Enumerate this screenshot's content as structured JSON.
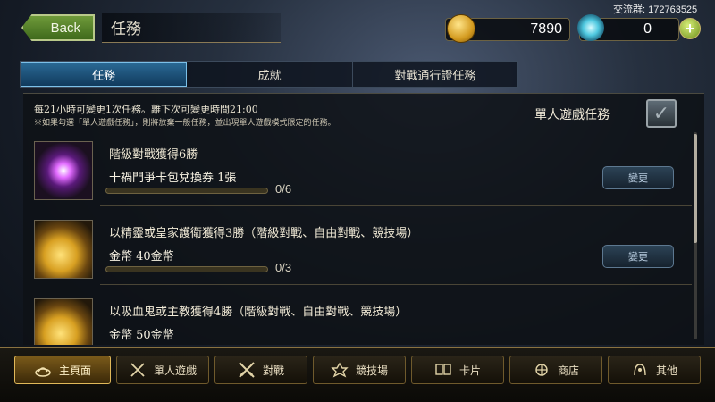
{
  "watermark": "交流群: 172763525",
  "header": {
    "back_label": "Back",
    "title": "任務"
  },
  "currency": {
    "gold": "7890",
    "crystals": "0",
    "add_label": "+"
  },
  "tabs": [
    {
      "label": "任務",
      "active": true
    },
    {
      "label": "成就",
      "active": false
    },
    {
      "label": "對戰通行證任務",
      "active": false
    }
  ],
  "info": {
    "line1": "每21小時可變更1次任務。離下次可變更時間21:00",
    "line2": "※如果勾選「單人遊戲任務」，則將放棄一般任務，並出現單人遊戲模式限定的任務。"
  },
  "solo_toggle": {
    "label": "單人遊戲任務",
    "checked": true
  },
  "missions": [
    {
      "title": "階級對戰獲得6勝",
      "reward": "十禍門爭卡包兌換券 1張",
      "progress": "0/6",
      "progress_fraction": 0,
      "button": "變更",
      "icon": "card-pack-icon"
    },
    {
      "title": "以精靈或皇家護衛獲得3勝（階級對戰、自由對戰、競技場）",
      "reward": "金幣 40金幣",
      "progress": "0/3",
      "progress_fraction": 0,
      "button": "變更",
      "icon": "gold-coins-icon"
    },
    {
      "title": "以吸血鬼或主教獲得4勝（階級對戰、自由對戰、競技場）",
      "reward": "金幣 50金幣",
      "progress": "",
      "progress_fraction": 0,
      "button": "",
      "icon": "gold-coins-icon"
    }
  ],
  "nav": [
    {
      "label": "主頁面",
      "icon": "home-icon",
      "active": true
    },
    {
      "label": "單人遊戲",
      "icon": "solo-icon",
      "active": false
    },
    {
      "label": "對戰",
      "icon": "battle-icon",
      "active": false
    },
    {
      "label": "競技場",
      "icon": "arena-icon",
      "active": false
    },
    {
      "label": "卡片",
      "icon": "cards-icon",
      "active": false
    },
    {
      "label": "商店",
      "icon": "shop-icon",
      "active": false
    },
    {
      "label": "其他",
      "icon": "other-icon",
      "active": false
    }
  ],
  "colors": {
    "accent_blue": "#2b6a96",
    "gold_border": "#8a7240"
  }
}
